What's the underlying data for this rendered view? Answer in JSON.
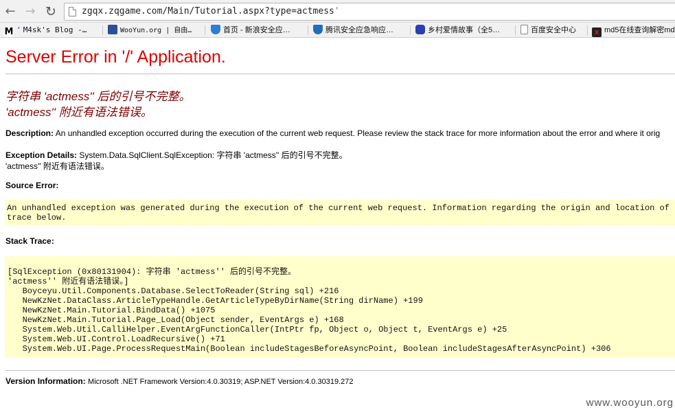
{
  "browser": {
    "url_main": "zgqx.zqgame.com/Main/Tutorial.aspx?type=actmess",
    "url_trail": "'",
    "bookmarks": [
      {
        "label": "M4sk's Blog -…",
        "icon": "m-logo-icon",
        "color": "#000000"
      },
      {
        "label": "WooYun.org | 自由…",
        "icon": "wooyun-icon",
        "color": "#2d4f9a"
      },
      {
        "label": "首页 - 新浪安全应…",
        "icon": "shield-icon",
        "color": "#2a7fd4"
      },
      {
        "label": "腾讯安全应急响应…",
        "icon": "shield-icon",
        "color": "#1f6fb8"
      },
      {
        "label": "乡村爱情故事（全5…",
        "icon": "paw-icon",
        "color": "#2b3fb0"
      },
      {
        "label": "百度安全中心",
        "icon": "page-icon",
        "color": "#ffffff"
      },
      {
        "label": "md5在线查询解密md…",
        "icon": "x-icon",
        "color": "#222222"
      }
    ]
  },
  "page": {
    "title": "Server Error in '/' Application.",
    "error_line1": "字符串 'actmess'' 后的引号不完整。",
    "error_line2": "'actmess'' 附近有语法错误。",
    "description_label": "Description:",
    "description_text": "An unhandled exception occurred during the execution of the current web request. Please review the stack trace for more information about the error and where it orig",
    "exception_label": "Exception Details:",
    "exception_text": "System.Data.SqlClient.SqlException: 字符串 'actmess'' 后的引号不完整。",
    "exception_text2": "'actmess'' 附近有语法错误。",
    "source_error_label": "Source Error:",
    "source_error_line1": "An unhandled exception was generated during the execution of the current web request. Information regarding the origin and location of the",
    "source_error_line2": "trace below.",
    "stack_trace_label": "Stack Trace:",
    "stack_lines": [
      "[SqlException (0x80131904): 字符串 'actmess'' 后的引号不完整。",
      "'actmess'' 附近有语法错误。]",
      "   Boyceyu.Util.Components.Database.SelectToReader(String sql) +216",
      "   NewKzNet.DataClass.ArticleTypeHandle.GetArticleTypeByDirName(String dirName) +199",
      "   NewKzNet.Main.Tutorial.BindData() +1075",
      "   NewKzNet.Main.Tutorial.Page_Load(Object sender, EventArgs e) +168",
      "   System.Web.Util.CalliHelper.EventArgFunctionCaller(IntPtr fp, Object o, Object t, EventArgs e) +25",
      "   System.Web.UI.Control.LoadRecursive() +71",
      "   System.Web.UI.Page.ProcessRequestMain(Boolean includeStagesBeforeAsyncPoint, Boolean includeStagesAfterAsyncPoint) +306"
    ],
    "version_label": "Version Information:",
    "version_text": "Microsoft .NET Framework Version:4.0.30319; ASP.NET Version:4.0.30319.272"
  },
  "watermark": "www.wooyun.org"
}
